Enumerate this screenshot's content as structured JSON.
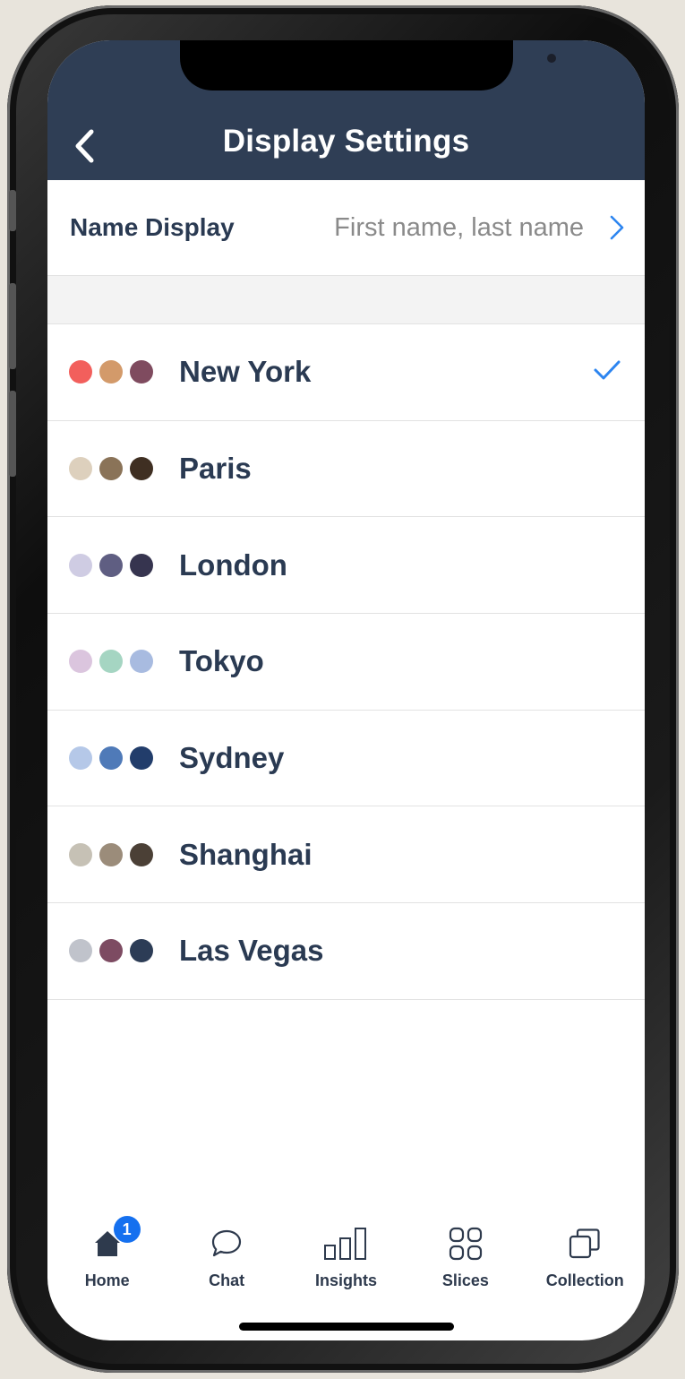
{
  "header": {
    "title": "Display Settings",
    "back_icon": "chevron-left-icon"
  },
  "name_display": {
    "label": "Name Display",
    "value": "First name, last name",
    "icon": "chevron-right-icon"
  },
  "themes": [
    {
      "name": "New York",
      "selected": true,
      "colors": [
        "#f25f5c",
        "#d39a6a",
        "#7f4b5f"
      ]
    },
    {
      "name": "Paris",
      "selected": false,
      "colors": [
        "#ddd0bd",
        "#8a7358",
        "#3f2f22"
      ]
    },
    {
      "name": "London",
      "selected": false,
      "colors": [
        "#cfcce3",
        "#5f5e82",
        "#36344f"
      ]
    },
    {
      "name": "Tokyo",
      "selected": false,
      "colors": [
        "#dbc5de",
        "#a5d5c2",
        "#a8bbe0"
      ]
    },
    {
      "name": "Sydney",
      "selected": false,
      "colors": [
        "#b5c8e8",
        "#4f7ab8",
        "#223d6b"
      ]
    },
    {
      "name": "Shanghai",
      "selected": false,
      "colors": [
        "#c6c1b5",
        "#9b8c7a",
        "#4b4036"
      ]
    },
    {
      "name": "Las Vegas",
      "selected": false,
      "colors": [
        "#c0c3cb",
        "#7d4b62",
        "#2c3c56"
      ]
    }
  ],
  "tabbar": {
    "tabs": [
      {
        "label": "Home",
        "icon": "home-icon",
        "badge": "1"
      },
      {
        "label": "Chat",
        "icon": "chat-bubble-icon"
      },
      {
        "label": "Insights",
        "icon": "bar-chart-icon"
      },
      {
        "label": "Slices",
        "icon": "grid-icon"
      },
      {
        "label": "Collection",
        "icon": "copy-stack-icon"
      }
    ]
  },
  "colors": {
    "header_bg": "#2f3e55",
    "accent": "#2d85f0",
    "text_dark": "#2a3a52",
    "text_muted": "#8a8a8a",
    "badge": "#1570ef"
  }
}
